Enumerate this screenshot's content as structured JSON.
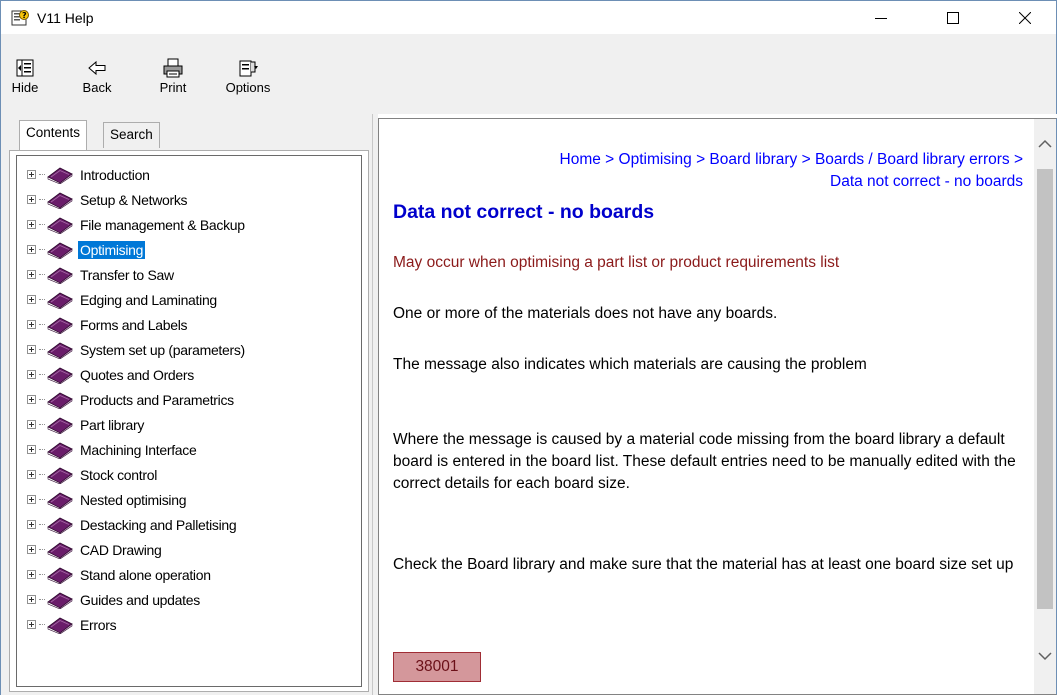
{
  "window": {
    "title": "V11 Help"
  },
  "toolbar": {
    "buttons": [
      {
        "label": "Hide",
        "icon": "hide-icon"
      },
      {
        "label": "Back",
        "icon": "back-arrow-icon"
      },
      {
        "label": "Print",
        "icon": "printer-icon"
      },
      {
        "label": "Options",
        "icon": "options-icon"
      }
    ]
  },
  "tabs": {
    "contents": "Contents",
    "search": "Search"
  },
  "tree": {
    "items": [
      "Introduction",
      "Setup & Networks",
      "File management & Backup",
      "Optimising",
      "Transfer to Saw",
      "Edging and Laminating",
      "Forms and Labels",
      "System set up (parameters)",
      "Quotes and Orders",
      "Products and Parametrics",
      "Part library",
      "Machining Interface",
      "Stock control",
      "Nested optimising",
      "Destacking and Palletising",
      "CAD Drawing",
      "Stand alone operation",
      "Guides and updates",
      "Errors"
    ],
    "selected": "Optimising"
  },
  "content": {
    "breadcrumb_line1": "Home > Optimising > Board library > Boards / Board library errors >",
    "breadcrumb_line2": "Data not correct - no boards",
    "heading": "Data not correct - no boards",
    "intro": "May occur when optimising a part list or product requirements list",
    "p1": "One or more of the materials does not have any boards.",
    "p2": "The message also indicates which materials are causing the problem",
    "p3": "Where the message is caused by a material code missing from the board library a default board is entered in the board list. These default entries need to be manually edited with the correct details for each board size.",
    "p4": "Check the Board library and make sure that the material has at least one board size set up",
    "code": "38001"
  },
  "colors": {
    "link": "#0000ff",
    "heading": "#0000cc",
    "intro": "#8b1a1a",
    "selection": "#0078d7",
    "code_bg": "#d4979b"
  }
}
